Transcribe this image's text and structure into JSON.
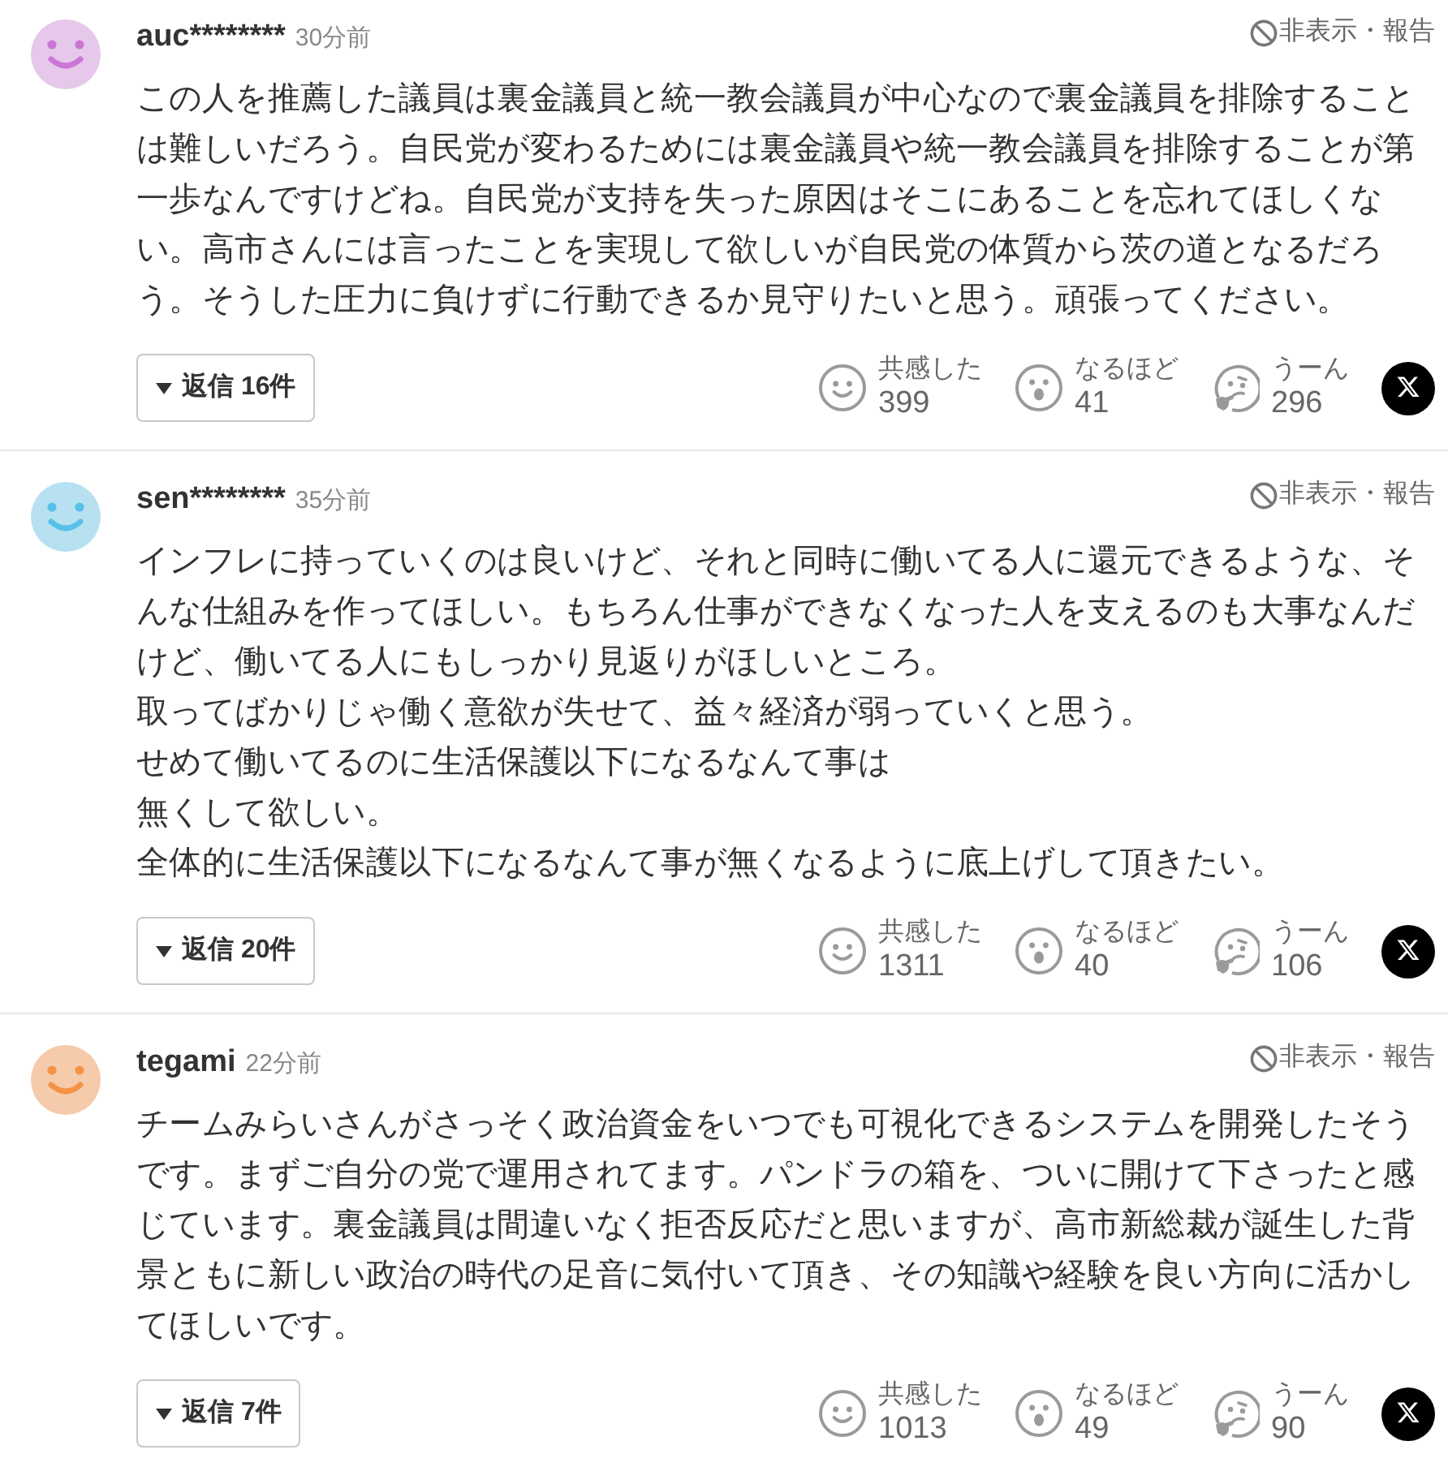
{
  "comments": [
    {
      "avatar": {
        "color": "#e6c9ea"
      },
      "user": "auc********",
      "time": "30分前",
      "hide_report": "非表示・報告",
      "body": [
        "この人を推薦した議員は裏金議員と統一教会議員が中心なので裏金議員を排除することは難しいだろう。自民党が変わるためには裏金議員や統一教会議員を排除することが第一歩なんですけどね。自民党が支持を失った原因はそこにあることを忘れてほしくない。高市さんには言ったことを実現して欲しいが自民党の体質から茨の道となるだろう。そうした圧力に負けずに行動できるか見守りたいと思う。頑張ってください。"
      ],
      "replies": "返信 16件",
      "reactions": [
        {
          "kind": "smile",
          "label": "共感した",
          "count": "399"
        },
        {
          "kind": "surprised",
          "label": "なるほど",
          "count": "41"
        },
        {
          "kind": "thinking",
          "label": "うーん",
          "count": "296"
        }
      ]
    },
    {
      "avatar": {
        "color": "#b7e1f1"
      },
      "user": "sen********",
      "time": "35分前",
      "hide_report": "非表示・報告",
      "body": [
        "インフレに持っていくのは良いけど、それと同時に働いてる人に還元できるような、そんな仕組みを作ってほしい。もちろん仕事ができなくなった人を支えるのも大事なんだけど、働いてる人にもしっかり見返りがほしいところ。",
        "取ってばかりじゃ働く意欲が失せて、益々経済が弱っていくと思う。",
        "せめて働いてるのに生活保護以下になるなんて事は",
        "無くして欲しい。",
        "全体的に生活保護以下になるなんて事が無くなるように底上げして頂きたい。"
      ],
      "replies": "返信 20件",
      "reactions": [
        {
          "kind": "smile",
          "label": "共感した",
          "count": "1311"
        },
        {
          "kind": "surprised",
          "label": "なるほど",
          "count": "40"
        },
        {
          "kind": "thinking",
          "label": "うーん",
          "count": "106"
        }
      ]
    },
    {
      "avatar": {
        "color": "#f5cbab"
      },
      "user": "tegami",
      "time": "22分前",
      "hide_report": "非表示・報告",
      "body": [
        "チームみらいさんがさっそく政治資金をいつでも可視化できるシステムを開発したそうです。まずご自分の党で運用されてます。パンドラの箱を、ついに開けて下さったと感じています。裏金議員は間違いなく拒否反応だと思いますが、高市新総裁が誕生した背景ともに新しい政治の時代の足音に気付いて頂き、その知識や経験を良い方向に活かしてほしいです。"
      ],
      "replies": "返信 7件",
      "reactions": [
        {
          "kind": "smile",
          "label": "共感した",
          "count": "1013"
        },
        {
          "kind": "surprised",
          "label": "なるほど",
          "count": "49"
        },
        {
          "kind": "thinking",
          "label": "うーん",
          "count": "90"
        }
      ]
    }
  ]
}
